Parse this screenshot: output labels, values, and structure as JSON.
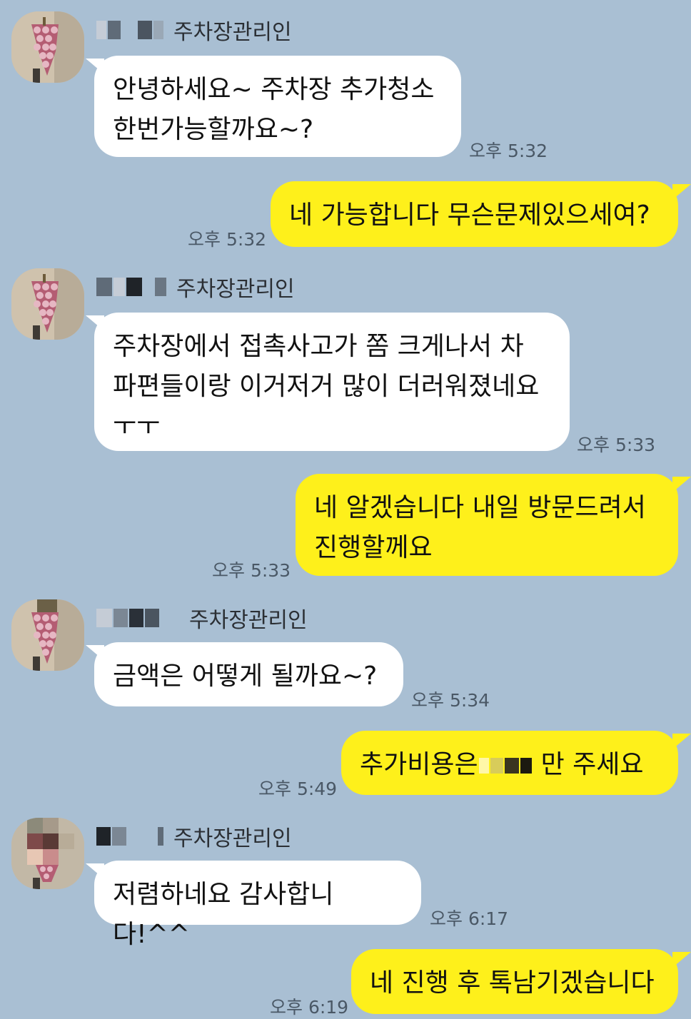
{
  "chat": {
    "sender_name": "주차장관리인",
    "messages": [
      {
        "id": "m1",
        "from": "other",
        "text": "안녕하세요~ 주차장 추가청소\n한번가능할까요~?",
        "time": "오후 5:32"
      },
      {
        "id": "m2",
        "from": "me",
        "text": "네 가능합니다 무슨문제있으세여?",
        "time": "오후 5:32"
      },
      {
        "id": "m3",
        "from": "other",
        "text": "주차장에서 접촉사고가 쫌 크게나서 차\n파편들이랑 이거저거 많이 더러워졌네요\nㅜㅜ",
        "time": "오후 5:33"
      },
      {
        "id": "m4",
        "from": "me",
        "text": "네 알겠습니다 내일 방문드려서\n진행할께요",
        "time": "오후 5:33"
      },
      {
        "id": "m5",
        "from": "other",
        "text": "금액은 어떻게 될까요~?",
        "time": "오후 5:34"
      },
      {
        "id": "m6",
        "from": "me",
        "text_before": "추가비용은",
        "text_after": "만 주세요",
        "time": "오후 5:49"
      },
      {
        "id": "m7",
        "from": "other",
        "text": "저렴하네요 감사합니다!^^",
        "time": "오후 6:17"
      },
      {
        "id": "m8",
        "from": "me",
        "text": "네 진행 후 톡남기겠습니다",
        "time": "오후 6:19"
      }
    ]
  },
  "colors": {
    "background": "#a9bfd3",
    "incoming_bubble": "#ffffff",
    "outgoing_bubble": "#fef01b",
    "timestamp": "#4a5866"
  },
  "icons": {
    "avatar": "grape-profile-image",
    "redaction": "pixelated-blur"
  }
}
